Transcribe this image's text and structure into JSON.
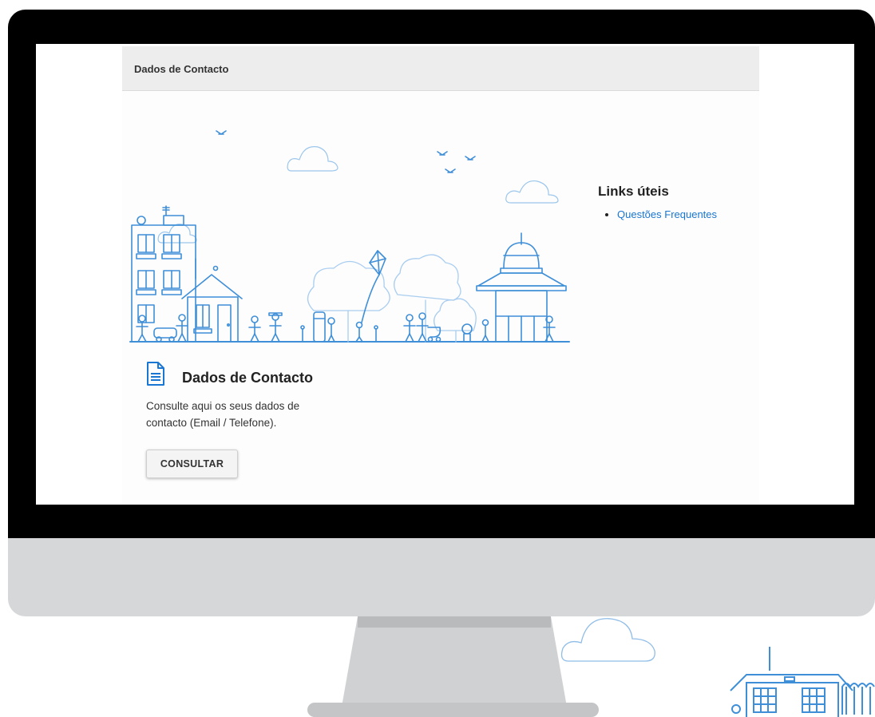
{
  "page": {
    "header_title": "Dados de Contacto"
  },
  "card": {
    "icon": "document-icon",
    "title": "Dados de Contacto",
    "description": "Consulte aqui os seus dados de contacto (Email / Telefone).",
    "button_label": "CONSULTAR"
  },
  "links": {
    "title": "Links úteis",
    "items": [
      {
        "label": "Questões Frequentes"
      }
    ]
  },
  "colors": {
    "accent": "#1976d2",
    "illustration_line": "#3f8fd8",
    "bezel": "#000000",
    "monitor_chin": "#d6d7d9"
  }
}
